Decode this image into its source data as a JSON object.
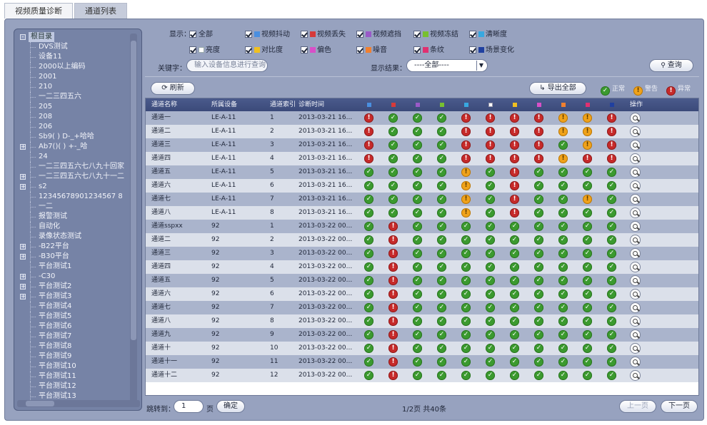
{
  "tabs": [
    "视频质量诊断",
    "通道列表"
  ],
  "active_tab": 1,
  "filters": {
    "display_label": "显示：",
    "options_row1": [
      {
        "label": "全部",
        "color": ""
      },
      {
        "label": "视频抖动",
        "color": "#4a8fe0"
      },
      {
        "label": "视频丢失",
        "color": "#d63a3a"
      },
      {
        "label": "视频遮挡",
        "color": "#9a5ac8"
      },
      {
        "label": "视频冻结",
        "color": "#78c030"
      },
      {
        "label": "清晰度",
        "color": "#38a8e0"
      }
    ],
    "options_row2": [
      {
        "label": "亮度",
        "color": "#ffffff"
      },
      {
        "label": "对比度",
        "color": "#f0c020"
      },
      {
        "label": "偏色",
        "color": "#d850c8"
      },
      {
        "label": "噪音",
        "color": "#f08030"
      },
      {
        "label": "条纹",
        "color": "#e03070"
      },
      {
        "label": "场景变化",
        "color": "#2040a0"
      }
    ],
    "keyword_label": "关键字：",
    "keyword_placeholder": "输入设备信息进行查询",
    "result_label": "显示结果：",
    "result_value": "----全部----",
    "query_button": "查询"
  },
  "toolbar": {
    "refresh": "刷新",
    "export": "导出全部",
    "legend": [
      "正常",
      "警告",
      "异常"
    ]
  },
  "table": {
    "headers": [
      "通道名称",
      "所属设备",
      "通道索引",
      "诊断时间",
      "操作"
    ],
    "status_colors": [
      "#4a8fe0",
      "#d63a3a",
      "#9a5ac8",
      "#78c030",
      "#38a8e0",
      "#ffffff",
      "#f0c020",
      "#d850c8",
      "#f08030",
      "#e03070",
      "#2040a0"
    ],
    "rows": [
      {
        "name": "通道一",
        "device": "LE-A-11",
        "index": "1",
        "time": "2013-03-21 16...",
        "s": "eoooeeeewwe"
      },
      {
        "name": "通道二",
        "device": "LE-A-11",
        "index": "2",
        "time": "2013-03-21 16...",
        "s": "eoooeeeewwe"
      },
      {
        "name": "通道三",
        "device": "LE-A-11",
        "index": "3",
        "time": "2013-03-21 16...",
        "s": "eoooeeeeowe"
      },
      {
        "name": "通道四",
        "device": "LE-A-11",
        "index": "4",
        "time": "2013-03-21 16...",
        "s": "eoooeeeewee"
      },
      {
        "name": "通道五",
        "device": "LE-A-11",
        "index": "5",
        "time": "2013-03-21 16...",
        "s": "oooowoeoooo"
      },
      {
        "name": "通道六",
        "device": "LE-A-11",
        "index": "6",
        "time": "2013-03-21 16...",
        "s": "oooowoeoooo"
      },
      {
        "name": "通道七",
        "device": "LE-A-11",
        "index": "7",
        "time": "2013-03-21 16...",
        "s": "oooowoeoowo"
      },
      {
        "name": "通道八",
        "device": "LE-A-11",
        "index": "8",
        "time": "2013-03-21 16...",
        "s": "oooowoeoooo"
      },
      {
        "name": "通道sspxx",
        "device": "92",
        "index": "1",
        "time": "2013-03-22 00...",
        "s": "oeooooooooo"
      },
      {
        "name": "通道二",
        "device": "92",
        "index": "2",
        "time": "2013-03-22 00...",
        "s": "oeooooooooo"
      },
      {
        "name": "通道三",
        "device": "92",
        "index": "3",
        "time": "2013-03-22 00...",
        "s": "oeooooooooo"
      },
      {
        "name": "通道四",
        "device": "92",
        "index": "4",
        "time": "2013-03-22 00...",
        "s": "oeooooooooo"
      },
      {
        "name": "通道五",
        "device": "92",
        "index": "5",
        "time": "2013-03-22 00...",
        "s": "oeooooooooo"
      },
      {
        "name": "通道六",
        "device": "92",
        "index": "6",
        "time": "2013-03-22 00...",
        "s": "oeooooooooo"
      },
      {
        "name": "通道七",
        "device": "92",
        "index": "7",
        "time": "2013-03-22 00...",
        "s": "oeooooooooo"
      },
      {
        "name": "通道八",
        "device": "92",
        "index": "8",
        "time": "2013-03-22 00...",
        "s": "oeooooooooo"
      },
      {
        "name": "通道九",
        "device": "92",
        "index": "9",
        "time": "2013-03-22 00...",
        "s": "oeooooooooo"
      },
      {
        "name": "通道十",
        "device": "92",
        "index": "10",
        "time": "2013-03-22 00...",
        "s": "oeooooooooo"
      },
      {
        "name": "通道十一",
        "device": "92",
        "index": "11",
        "time": "2013-03-22 00...",
        "s": "oeooooooooo"
      },
      {
        "name": "通道十二",
        "device": "92",
        "index": "12",
        "time": "2013-03-22 00...",
        "s": "oeooooooooo"
      }
    ]
  },
  "tree": [
    {
      "label": "根目录",
      "level": 0,
      "exp": "-"
    },
    {
      "label": "DVS测试",
      "level": 1
    },
    {
      "label": "设备11",
      "level": 1
    },
    {
      "label": "2000以上编码",
      "level": 1
    },
    {
      "label": "2001",
      "level": 1
    },
    {
      "label": "210",
      "level": 1
    },
    {
      "label": "一二三四五六",
      "level": 1
    },
    {
      "label": "205",
      "level": 1
    },
    {
      "label": "208",
      "level": 1
    },
    {
      "label": "206",
      "level": 1
    },
    {
      "label": "Sb9( ) D-_+哈哈",
      "level": 1
    },
    {
      "label": "Ab7()( ) +-_哈",
      "level": 1,
      "exp": "+"
    },
    {
      "label": "24",
      "level": 1
    },
    {
      "label": "一二三四五六七八九十回家",
      "level": 1
    },
    {
      "label": "一二三四五六七八九十一二",
      "level": 1,
      "exp": "+"
    },
    {
      "label": "s2",
      "level": 1,
      "exp": "+"
    },
    {
      "label": "12345678901234567 8",
      "level": 1
    },
    {
      "label": "一二",
      "level": 1
    },
    {
      "label": "报警测试",
      "level": 1
    },
    {
      "label": "自动化",
      "level": 1
    },
    {
      "label": "录像状态测试",
      "level": 1
    },
    {
      "label": "-B22平台",
      "level": 1,
      "exp": "+"
    },
    {
      "label": "-B30平台",
      "level": 1,
      "exp": "+"
    },
    {
      "label": "平台测试1",
      "level": 1
    },
    {
      "label": "-C30",
      "level": 1,
      "exp": "+"
    },
    {
      "label": "平台测试2",
      "level": 1,
      "exp": "+"
    },
    {
      "label": "平台测试3",
      "level": 1,
      "exp": "+"
    },
    {
      "label": "平台测试4",
      "level": 1
    },
    {
      "label": "平台测试5",
      "level": 1
    },
    {
      "label": "平台测试6",
      "level": 1
    },
    {
      "label": "平台测试7",
      "level": 1
    },
    {
      "label": "平台测试8",
      "level": 1
    },
    {
      "label": "平台测试9",
      "level": 1
    },
    {
      "label": "平台测试10",
      "level": 1
    },
    {
      "label": "平台测试11",
      "level": 1
    },
    {
      "label": "平台测试12",
      "level": 1
    },
    {
      "label": "平台测试13",
      "level": 1
    }
  ],
  "pager": {
    "jump_label": "跳转到：",
    "jump_value": "1",
    "page_unit": "页",
    "confirm": "确定",
    "info": "1/2页 共40条",
    "prev": "上一页",
    "next": "下一页"
  }
}
